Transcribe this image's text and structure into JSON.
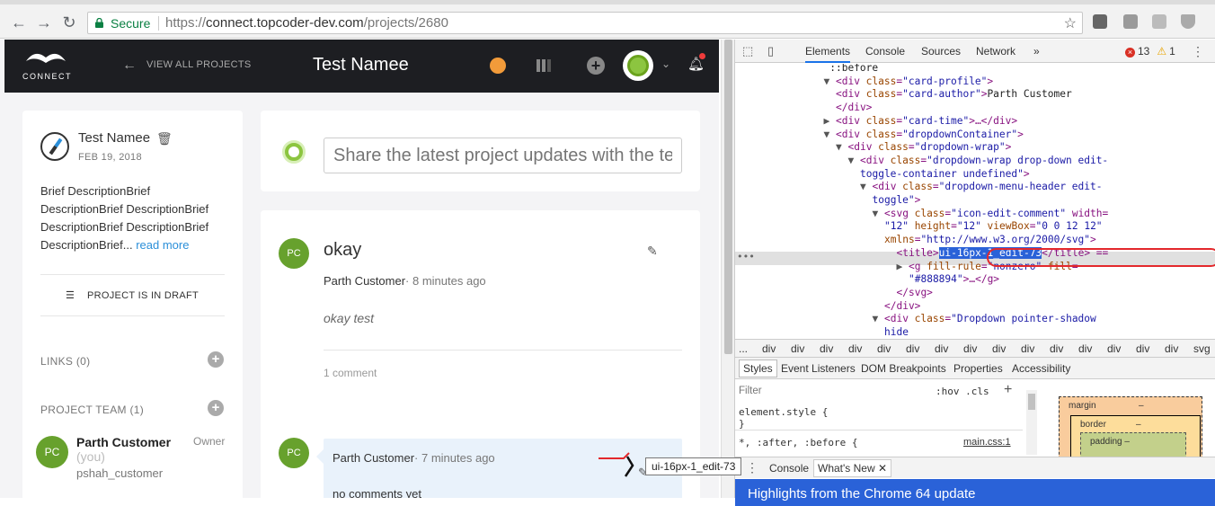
{
  "browser": {
    "secure_label": "Secure",
    "url_scheme": "https://",
    "url_host": "connect.topcoder-dev.com",
    "url_path": "/projects/2680"
  },
  "app": {
    "logo_text": "CONNECT",
    "view_all": "VIEW ALL PROJECTS",
    "project_title": "Test Namee"
  },
  "sidebar": {
    "project_name": "Test Namee",
    "date": "FEB 19, 2018",
    "description": "Brief DescriptionBrief DescriptionBrief DescriptionBrief DescriptionBrief DescriptionBrief DescriptionBrief...",
    "read_more": "read more",
    "draft_status": "PROJECT IS IN DRAFT",
    "links_label": "LINKS (0)",
    "team_label": "PROJECT TEAM (1)",
    "member": {
      "initials": "PC",
      "name": "Parth Customer",
      "you": "(you)",
      "role": "Owner",
      "handle": "pshah_customer"
    }
  },
  "post_box": {
    "placeholder": "Share the latest project updates with the te"
  },
  "feed": {
    "initials": "PC",
    "title": "okay",
    "author": "Parth Customer",
    "time": "· 8 minutes ago",
    "body": "okay test",
    "comment_count": "1 comment",
    "comment": {
      "initials": "PC",
      "author": "Parth Customer",
      "time": "· 7 minutes ago",
      "text": "no comments yet"
    }
  },
  "tooltip": "ui-16px-1_edit-73",
  "devtools": {
    "tabs": [
      "Elements",
      "Console",
      "Sources",
      "Network"
    ],
    "more": "»",
    "error_count": "13",
    "warn_count": "1",
    "dom_lines": [
      {
        "i": 15,
        "t": "::before",
        "cls": "tx"
      },
      {
        "i": 14,
        "open": "▼",
        "tag": "<div ",
        "attr": "class",
        "val": "\"card-profile\"",
        "end": ">"
      },
      {
        "i": 16,
        "tag": "<div ",
        "attr": "class",
        "val": "\"card-author\"",
        "end": ">",
        "text": "Parth Customer"
      },
      {
        "i": 16,
        "tag": "</div>"
      },
      {
        "i": 14,
        "open": "▶",
        "tag": "<div ",
        "attr": "class",
        "val": "\"card-time\"",
        "end": ">…</div>"
      },
      {
        "i": 14,
        "open": "▼",
        "tag": "<div ",
        "attr": "class",
        "val": "\"dropdownContainer\"",
        "end": ">"
      },
      {
        "i": 16,
        "open": "▼",
        "tag": "<div ",
        "attr": "class",
        "val": "\"dropdown-wrap\"",
        "end": ">"
      },
      {
        "i": 18,
        "open": "▼",
        "tag": "<div ",
        "attr": "class",
        "val": "\"dropdown-wrap drop-down edit-",
        "end": ""
      },
      {
        "i": 20,
        "val": "toggle-container undefined\"",
        "end": ">"
      },
      {
        "i": 20,
        "open": "▼",
        "tag": "<div ",
        "attr": "class",
        "val": "\"dropdown-menu-header edit-",
        "end": ""
      },
      {
        "i": 22,
        "val": "toggle\"",
        "end": ">"
      },
      {
        "i": 22,
        "open": "▼",
        "tag": "<svg ",
        "attr": "class",
        "val": "\"icon-edit-comment\"",
        "end": " width="
      },
      {
        "i": 24,
        "val": "\"12\"",
        "attr2": " height",
        "val2": "\"12\"",
        "attr3": " viewBox",
        "val3": "\"0 0 12 12\""
      },
      {
        "i": 24,
        "attr": "xmlns",
        "val": "\"http://www.w3.org/2000/svg\"",
        "end": ">"
      },
      {
        "i": 26,
        "sel": true,
        "tag": "<title>",
        "hl": "ui-16px-1_edit-73",
        "end": "</title> =="
      },
      {
        "i": 26,
        "open": "▶",
        "tag": "<g ",
        "attr": "fill-rule",
        "val": "\"nonzero\"",
        "attr2": " fill",
        "val2": "="
      },
      {
        "i": 28,
        "val": "\"#888894\"",
        "end": ">…</g>"
      },
      {
        "i": 26,
        "tag": "</svg>"
      },
      {
        "i": 24,
        "tag": "</div>"
      },
      {
        "i": 22,
        "open": "▼",
        "tag": "<div ",
        "attr": "class",
        "val": "\"Dropdown pointer-shadow",
        "end": ""
      },
      {
        "i": 24,
        "val": "hide",
        "end": ""
      }
    ],
    "breadcrumbs": [
      "...",
      "div",
      "div",
      "div",
      "div",
      "div",
      "div",
      "div",
      "div",
      "div",
      "div",
      "div",
      "div",
      "div",
      "div",
      "div",
      "svg",
      "title"
    ],
    "subtabs": [
      "Styles",
      "Event Listeners",
      "DOM Breakpoints",
      "Properties",
      "Accessibility"
    ],
    "filter": "Filter",
    "hov_cls": ":hov  .cls",
    "element_style": "element.style {",
    "close_brace": "}",
    "rule_selector": "*, :after, :before {",
    "rule_source": "main.css:1",
    "box_margin": "margin",
    "box_border": "border",
    "box_padding": "padding",
    "box_dash": "–",
    "drawer_console": "Console",
    "drawer_whats_new": "What's New",
    "banner": "Highlights from the Chrome 64 update"
  }
}
